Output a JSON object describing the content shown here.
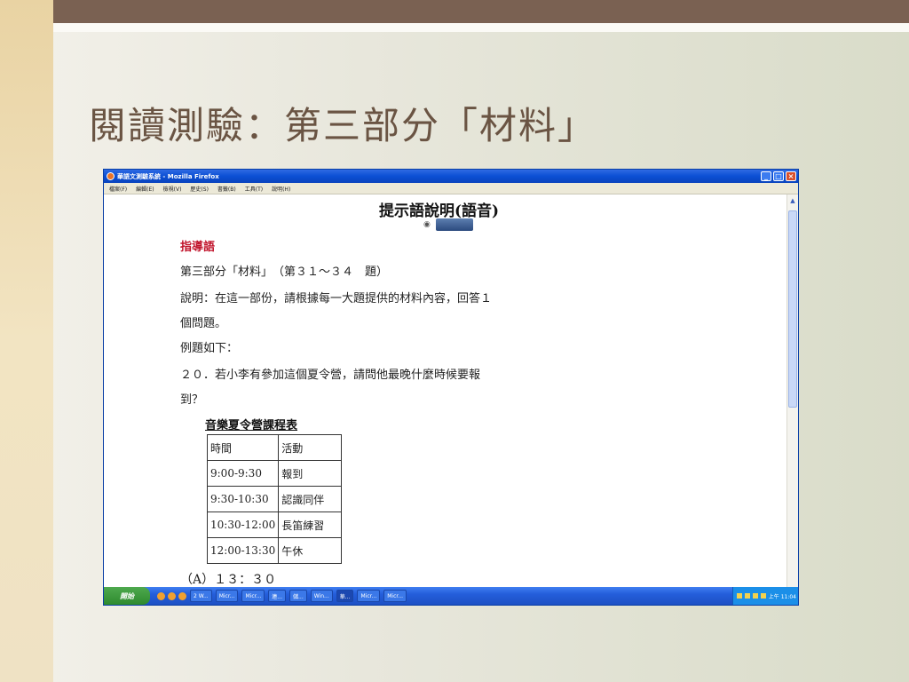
{
  "slide": {
    "title": "閱讀測驗：第三部分「材料」"
  },
  "window": {
    "title": "華語文測驗系統 - Mozilla Firefox",
    "menu": [
      "檔案(F)",
      "編輯(E)",
      "檢視(V)",
      "歷史(S)",
      "書籤(B)",
      "工具(T)",
      "說明(H)"
    ]
  },
  "page": {
    "heading": "提示語說明(語音)",
    "guide_label": "指導語",
    "lines": [
      "第三部分「材料」　（第３１～３４　題）",
      "說明：在這一部份，請根據每一大題提供的材料內容，回答１",
      "個問題。",
      "例題如下：",
      "２０．若小李有參加這個夏令營，請問他最晚什麼時候要報",
      "到？"
    ],
    "schedule_title": "音樂夏令營課程表",
    "schedule": [
      [
        "時間",
        "活動"
      ],
      [
        "9:00-9:30",
        "報到"
      ],
      [
        "9:30-10:30",
        "認識同伴"
      ],
      [
        "10:30-12:00",
        "長笛練習"
      ],
      [
        "12:00-13:30",
        "午休"
      ]
    ],
    "option_a": "（A）１３：３０"
  },
  "taskbar": {
    "start_label": "開始",
    "tasks": [
      "2 W...",
      "Micr...",
      "Micr...",
      "連...",
      "儲...",
      "Win...",
      "華...",
      "Micr...",
      "Micr..."
    ],
    "clock": "上午 11:04"
  },
  "colors": {
    "title_color": "#6a5443",
    "guide_color": "#c0122a",
    "top_band": "#7a6152"
  }
}
